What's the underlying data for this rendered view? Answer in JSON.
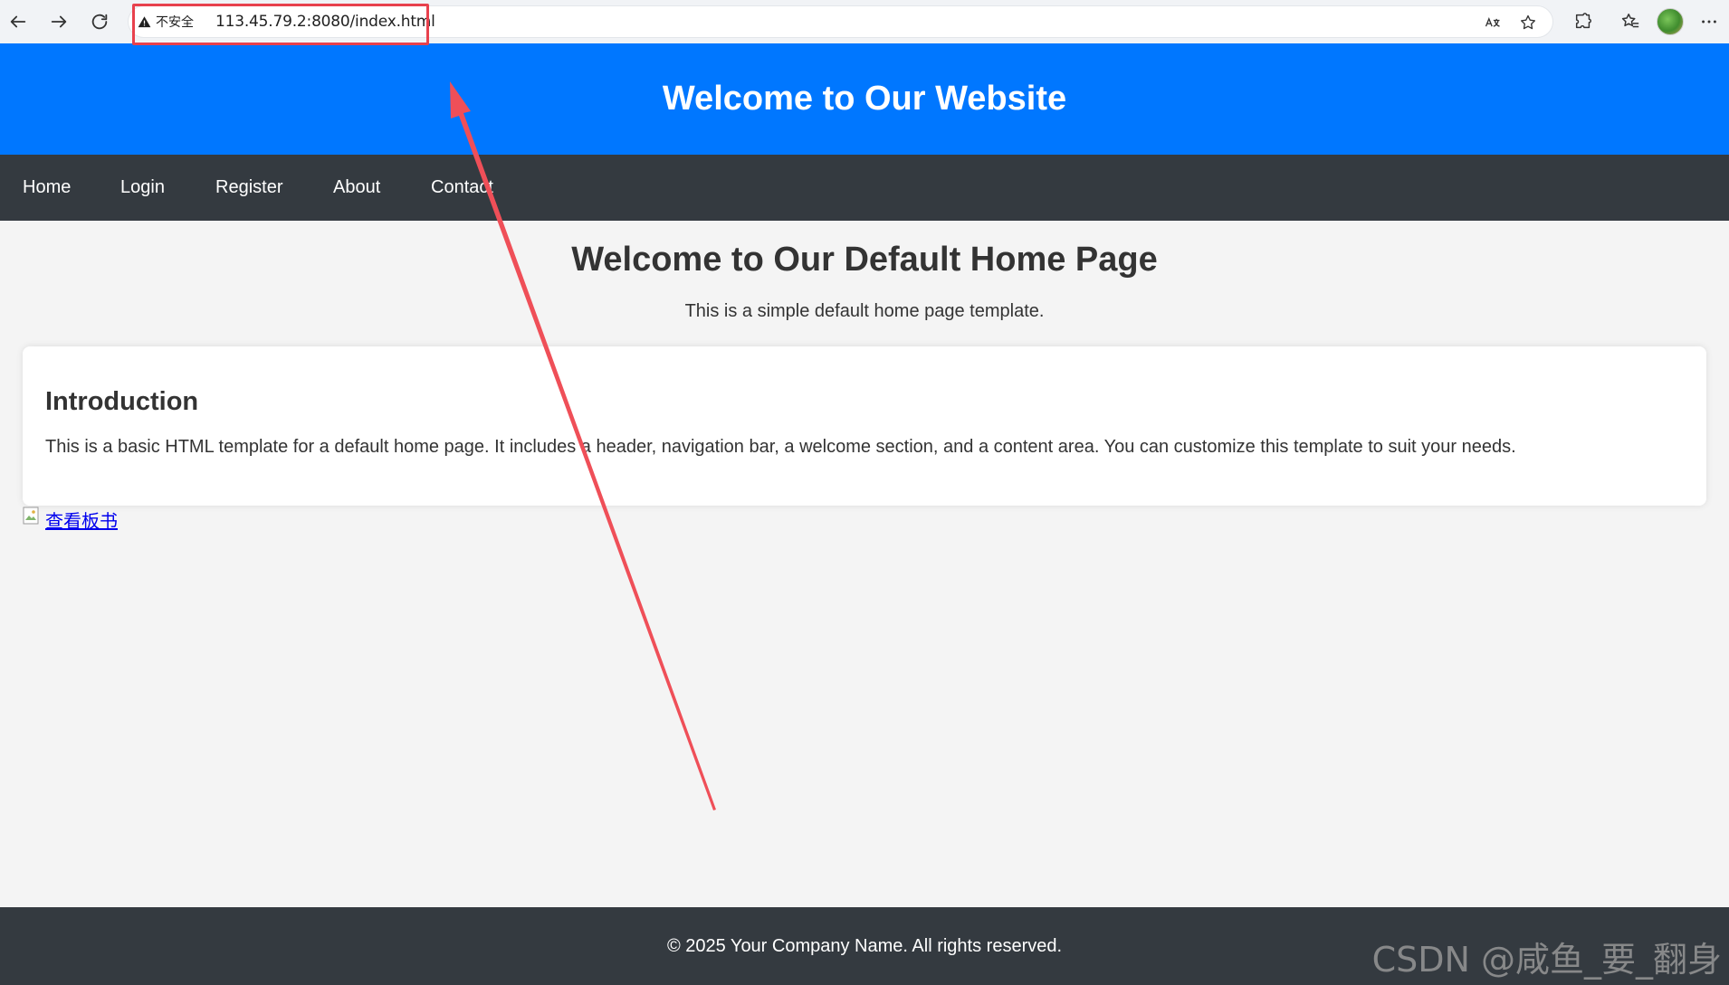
{
  "browser": {
    "security_label": "不安全",
    "url": "113.45.79.2:8080/index.html"
  },
  "header": {
    "title": "Welcome to Our Website"
  },
  "nav": {
    "items": [
      {
        "label": "Home"
      },
      {
        "label": "Login"
      },
      {
        "label": "Register"
      },
      {
        "label": "About"
      },
      {
        "label": "Contact"
      }
    ]
  },
  "welcome": {
    "title": "Welcome to Our Default Home Page",
    "subtitle": "This is a simple default home page template."
  },
  "intro": {
    "title": "Introduction",
    "text": "This is a basic HTML template for a default home page. It includes a header, navigation bar, a welcome section, and a content area. You can customize this template to suit your needs."
  },
  "link": {
    "label": "查看板书"
  },
  "footer": {
    "text": "© 2025 Your Company Name. All rights reserved."
  },
  "watermark": "CSDN @咸鱼_要_翻身",
  "colors": {
    "header_bg": "#0077ff",
    "nav_bg": "#343a40",
    "annotation_red": "#e8414d"
  }
}
